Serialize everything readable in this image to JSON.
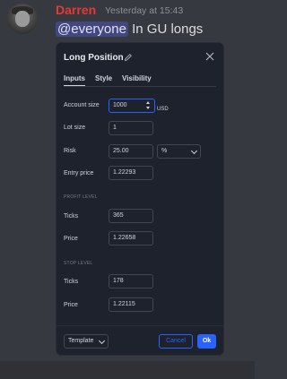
{
  "message": {
    "username": "Darren",
    "timestamp": "Yesterday at 15:43",
    "mention": "@everyone",
    "text": " In GU longs"
  },
  "dialog": {
    "title": "Long Position",
    "tabs": [
      "Inputs",
      "Style",
      "Visibility"
    ],
    "active_tab": "Inputs",
    "account_size": {
      "label": "Account size",
      "value": "1000",
      "unit": "USD"
    },
    "lot_size": {
      "label": "Lot size",
      "value": "1"
    },
    "risk": {
      "label": "Risk",
      "value": "25.00",
      "type": "%"
    },
    "entry_price": {
      "label": "Entry price",
      "value": "1.22293"
    },
    "profit_level": {
      "section": "PROFIT LEVEL",
      "ticks_label": "Ticks",
      "ticks": "365",
      "price_label": "Price",
      "price": "1.22658"
    },
    "stop_level": {
      "section": "STOP LEVEL",
      "ticks_label": "Ticks",
      "ticks": "178",
      "price_label": "Price",
      "price": "1.22115"
    },
    "footer": {
      "template": "Template",
      "cancel": "Cancel",
      "ok": "Ok"
    }
  },
  "colors": {
    "username": "#e53935",
    "accent": "#2962ff",
    "dialog_bg": "#1e222d",
    "chat_bg": "#36393f"
  },
  "icons": [
    "pencil-icon",
    "close-icon",
    "chevron-down-icon",
    "spinner-arrows-icon"
  ]
}
